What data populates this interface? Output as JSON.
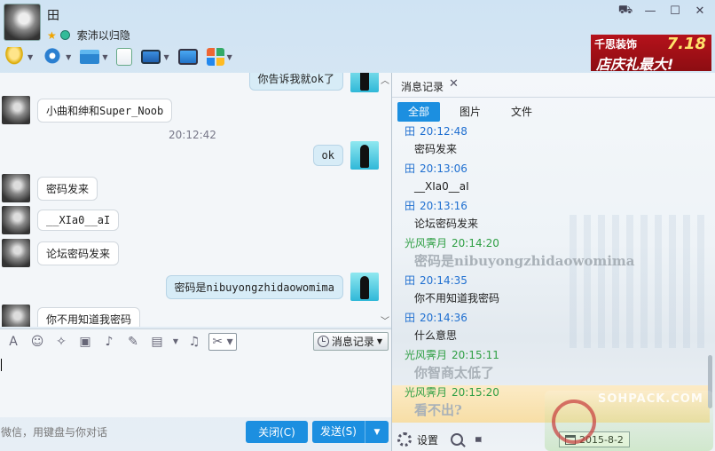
{
  "header": {
    "contact_name": "田",
    "signature": "索沛以归隐",
    "window_controls": {
      "skin": "⛟",
      "minimize": "—",
      "maximize": "☐",
      "close": "✕"
    }
  },
  "toolbar": {
    "items": [
      {
        "name": "voice-call",
        "icon": "mic-icon"
      },
      {
        "name": "video-call",
        "icon": "camera-icon"
      },
      {
        "name": "send-file",
        "icon": "folder-icon"
      },
      {
        "name": "create-doc",
        "icon": "document-icon"
      },
      {
        "name": "remote-desktop",
        "icon": "screen-icon"
      },
      {
        "name": "share-screen",
        "icon": "share-icon"
      },
      {
        "name": "apps",
        "icon": "apps-icon"
      }
    ]
  },
  "ad": {
    "brand": "千思装饰",
    "date": "7.18",
    "slogan": "店庆礼最大!"
  },
  "chat": {
    "messages": [
      {
        "side": "right",
        "text": "你告诉我就ok了"
      },
      {
        "side": "left",
        "text": "小曲和绅和Super_Noob"
      },
      {
        "side": "right",
        "text": "ok"
      },
      {
        "side": "left",
        "text": "密码发来"
      },
      {
        "side": "left",
        "text": "__XIa0__aI"
      },
      {
        "side": "left",
        "text": "论坛密码发来"
      },
      {
        "side": "right",
        "text": "密码是nibuyongzhidaowomima"
      },
      {
        "side": "left",
        "text": "你不用知道我密码"
      }
    ],
    "time_divider": "20:12:42"
  },
  "input": {
    "history_button": "消息记录",
    "hint": "微信，用键盘与你对话",
    "close_button": "关闭(C)",
    "send_button": "发送(S)"
  },
  "history": {
    "title": "消息记录",
    "filters": [
      "全部",
      "图片",
      "文件"
    ],
    "entries": [
      {
        "who": "peer",
        "name": "田",
        "time": "20:12:48",
        "text": "密码发来",
        "bold": false
      },
      {
        "who": "peer",
        "name": "田",
        "time": "20:13:06",
        "text": "__XIa0__aI",
        "bold": false
      },
      {
        "who": "peer",
        "name": "田",
        "time": "20:13:16",
        "text": "论坛密码发来",
        "bold": false
      },
      {
        "who": "me",
        "name": "光风霁月",
        "time": "20:14:20",
        "text": "密码是nibuyongzhidaowomima",
        "bold": true
      },
      {
        "who": "peer",
        "name": "田",
        "time": "20:14:35",
        "text": "你不用知道我密码",
        "bold": false
      },
      {
        "who": "peer",
        "name": "田",
        "time": "20:14:36",
        "text": "什么意思",
        "bold": false
      },
      {
        "who": "me",
        "name": "光风霁月",
        "time": "20:15:11",
        "text": "你智商太低了",
        "bold": true
      },
      {
        "who": "me",
        "name": "光风霁月",
        "time": "20:15:20",
        "text": "看不出?",
        "bold": true,
        "highlight": true
      }
    ],
    "footer": {
      "settings": "设置",
      "date": "2015-8-2"
    }
  },
  "watermark": {
    "text": "SOHPACK.COM"
  },
  "colors": {
    "accent": "#1c8fe0",
    "peer_name": "#1f6fd0",
    "me_name": "#2f9f44",
    "ad_red": "#b5121b"
  }
}
